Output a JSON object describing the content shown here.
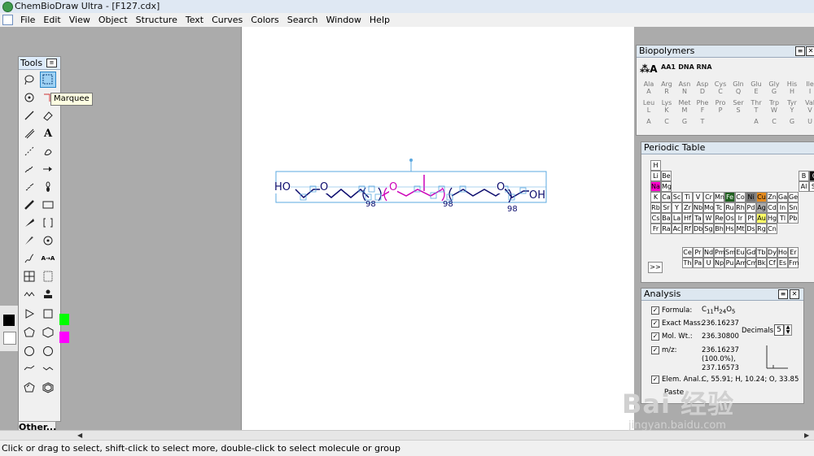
{
  "window": {
    "title": "ChemBioDraw Ultra - [F127.cdx]"
  },
  "menu": [
    "File",
    "Edit",
    "View",
    "Object",
    "Structure",
    "Text",
    "Curves",
    "Colors",
    "Search",
    "Window",
    "Help"
  ],
  "tools_palette": {
    "title": "Tools",
    "tooltip": "Marquee",
    "other_button": "Other..."
  },
  "status": {
    "text": "Click or drag to select, shift-click to select more, double-click to select molecule or group"
  },
  "structure": {
    "left_group": "HO",
    "right_group": "OH",
    "oxygens": [
      "O",
      "O",
      "O"
    ],
    "repeat_counts": [
      "98",
      "98",
      "98"
    ],
    "colors": {
      "blue_chain": "#0d0d6e",
      "magenta_chain": "#cc00b8",
      "selection": "#5ba8e0"
    }
  },
  "biopolymers": {
    "title": "Biopolymers",
    "header": [
      "AA1",
      "DNA",
      "RNA"
    ],
    "rows": [
      [
        "Ala",
        "Arg",
        "Asn",
        "Asp",
        "Cys",
        "Gln",
        "Glu",
        "Gly",
        "His",
        "Ile"
      ],
      [
        "A",
        "R",
        "N",
        "D",
        "C",
        "Q",
        "E",
        "G",
        "H",
        "I"
      ],
      [
        "Leu",
        "Lys",
        "Met",
        "Phe",
        "Pro",
        "Ser",
        "Thr",
        "Trp",
        "Tyr",
        "Val"
      ],
      [
        "L",
        "K",
        "M",
        "F",
        "P",
        "S",
        "T",
        "W",
        "Y",
        "V"
      ],
      [
        "A",
        "C",
        "G",
        "T",
        "",
        "",
        "A",
        "C",
        "G",
        "U"
      ]
    ]
  },
  "periodic_table": {
    "title": "Periodic Table",
    "expand_label": ">>",
    "highlight_colors": {
      "Na": "#ff00cc",
      "Fe": "#1e5e1e",
      "C": "#111111",
      "Ni": "#777777",
      "Cu": "#e38a1e",
      "Ag": "#aaaaaa",
      "Au": "#ffff66"
    },
    "rows": [
      [
        "H"
      ],
      [
        "Li",
        "Be"
      ],
      [
        "Na",
        "Mg"
      ],
      [
        "K",
        "Ca",
        "Sc",
        "Ti",
        "V",
        "Cr",
        "Mn",
        "Fe",
        "Co",
        "Ni",
        "Cu",
        "Zn",
        "Ga",
        "Ge"
      ],
      [
        "Rb",
        "Sr",
        "Y",
        "Zr",
        "Nb",
        "Mo",
        "Tc",
        "Ru",
        "Rh",
        "Pd",
        "Ag",
        "Cd",
        "In",
        "Sn"
      ],
      [
        "Cs",
        "Ba",
        "La",
        "Hf",
        "Ta",
        "W",
        "Re",
        "Os",
        "Ir",
        "Pt",
        "Au",
        "Hg",
        "Tl",
        "Pb"
      ],
      [
        "Fr",
        "Ra",
        "Ac",
        "Rf",
        "Db",
        "Sg",
        "Bh",
        "Hs",
        "Mt",
        "Ds",
        "Rg",
        "Cn"
      ]
    ],
    "right_block": [
      [
        "B",
        "C"
      ],
      [
        "Al",
        "Si"
      ]
    ],
    "lanthanides": [
      "Ce",
      "Pr",
      "Nd",
      "Pm",
      "Sm",
      "Eu",
      "Gd",
      "Tb",
      "Dy",
      "Ho",
      "Er"
    ],
    "actinides": [
      "Th",
      "Pa",
      "U",
      "Np",
      "Pu",
      "Am",
      "Cm",
      "Bk",
      "Cf",
      "Es",
      "Fm"
    ]
  },
  "analysis": {
    "title": "Analysis",
    "formula_label": "Formula:",
    "formula": {
      "C": "C",
      "c_sub": "11",
      "H": "H",
      "h_sub": "24",
      "O": "O",
      "o_sub": "5"
    },
    "exact_mass_label": "Exact Mass:",
    "exact_mass": "236.16237",
    "mol_wt_label": "Mol. Wt.:",
    "mol_wt": "236.30800",
    "mz_label": "m/z:",
    "mz_lines": [
      "236.16237",
      "(100.0%),",
      "237.16573"
    ],
    "decimals_label": "Decimals:",
    "decimals_value": "5",
    "elem_anal_label": "Elem. Anal.:",
    "elem_anal": "C, 55.91; H, 10.24; O, 33.85",
    "paste_label": "Paste"
  },
  "watermark": {
    "text": "Bai 经验",
    "sub": "jingyan.baidu.com"
  }
}
